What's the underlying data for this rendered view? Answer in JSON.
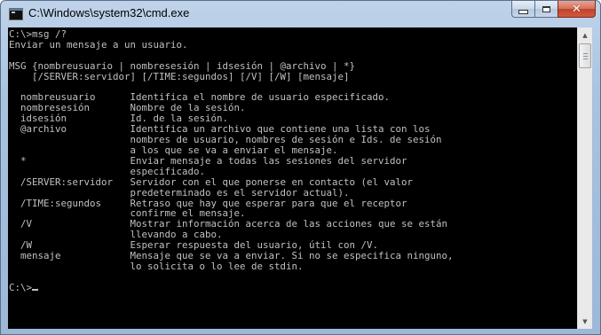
{
  "window": {
    "title": "C:\\Windows\\system32\\cmd.exe",
    "icon": "cmd-icon"
  },
  "caption_buttons": {
    "minimize": "minimize-icon",
    "maximize": "maximize-icon",
    "close": "close-icon"
  },
  "console": {
    "background": "#000000",
    "foreground": "#c0c0c0",
    "text": "C:\\>msg /?\nEnviar un mensaje a un usuario.\n\nMSG {nombreusuario | nombresesión | idsesión | @archivo | *}\n    [/SERVER:servidor] [/TIME:segundos] [/V] [/W] [mensaje]\n\n  nombreusuario      Identifica el nombre de usuario especificado.\n  nombresesión       Nombre de la sesión.\n  idsesión           Id. de la sesión.\n  @archivo           Identifica un archivo que contiene una lista con los\n                     nombres de usuario, nombres de sesión e Ids. de sesión\n                     a los que se va a enviar el mensaje.\n  *                  Enviar mensaje a todas las sesiones del servidor\n                     especificado.\n  /SERVER:servidor   Servidor con el que ponerse en contacto (el valor\n                     predeterminado es el servidor actual).\n  /TIME:segundos     Retraso que hay que esperar para que el receptor\n                     confirme el mensaje.\n  /V                 Mostrar información acerca de las acciones que se están\n                     llevando a cabo.\n  /W                 Esperar respuesta del usuario, útil con /V.\n  mensaje            Mensaje que se va a enviar. Si no se especifica ninguno,\n                     lo solicita o lo lee de stdin.\n\n",
    "prompt": "C:\\>"
  },
  "scrollbar": {
    "up": "scroll-up-arrow-icon",
    "down": "scroll-down-arrow-icon"
  }
}
